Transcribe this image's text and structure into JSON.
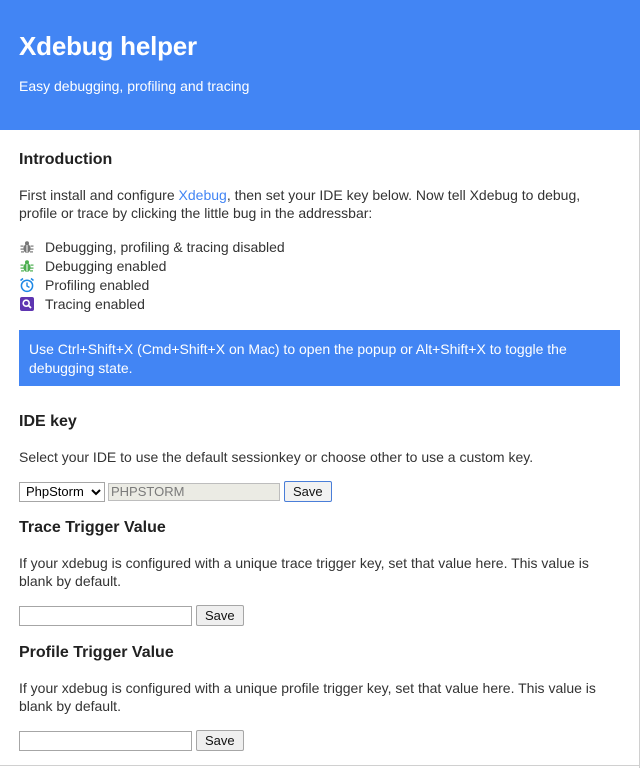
{
  "header": {
    "title": "Xdebug helper",
    "subtitle": "Easy debugging, profiling and tracing"
  },
  "intro": {
    "heading": "Introduction",
    "text_before_link": "First install and configure ",
    "link_text": "Xdebug",
    "text_after_link": ", then set your IDE key below. Now tell Xdebug to debug, profile or trace by clicking the little bug in the addressbar:",
    "statuses": [
      {
        "icon": "bug-disabled-icon",
        "label": "Debugging, profiling & tracing disabled"
      },
      {
        "icon": "bug-enabled-icon",
        "label": "Debugging enabled"
      },
      {
        "icon": "clock-icon",
        "label": "Profiling enabled"
      },
      {
        "icon": "trace-icon",
        "label": "Tracing enabled"
      }
    ],
    "shortcut_note": "Use Ctrl+Shift+X (Cmd+Shift+X on Mac) to open the popup or Alt+Shift+X to toggle the debugging state."
  },
  "ide": {
    "heading": "IDE key",
    "description": "Select your IDE to use the default sessionkey or choose other to use a custom key.",
    "selected_ide": "PhpStorm",
    "key_value": "PHPSTORM",
    "save_label": "Save"
  },
  "trace": {
    "heading": "Trace Trigger Value",
    "description": "If your xdebug is configured with a unique trace trigger key, set that value here. This value is blank by default.",
    "value": "",
    "save_label": "Save"
  },
  "profile": {
    "heading": "Profile Trigger Value",
    "description": "If your xdebug is configured with a unique profile trigger key, set that value here. This value is blank by default.",
    "value": "",
    "save_label": "Save"
  },
  "colors": {
    "accent": "#4285f4",
    "bug_disabled": "#777777",
    "bug_enabled": "#4caf50",
    "profiling": "#1e88e5",
    "tracing": "#5e35b1"
  }
}
